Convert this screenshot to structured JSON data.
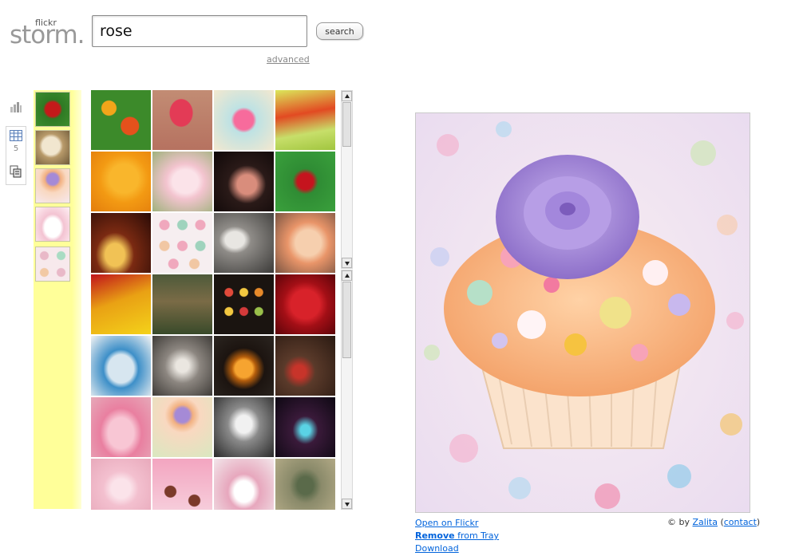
{
  "logo": {
    "small": "flickr",
    "big": "storm."
  },
  "search": {
    "value": "rose",
    "button": "search",
    "advanced": "advanced"
  },
  "sidebar": {
    "tray_count": "5"
  },
  "icons": {
    "tool_1": "bar-graph-icon",
    "tool_2": "grid-view-icon",
    "tool_3": "copy-icon"
  },
  "tray": {
    "items": [
      {
        "subject": "red rose"
      },
      {
        "subject": "dog on grass"
      },
      {
        "subject": "purple rose cupcake"
      },
      {
        "subject": "pink cake"
      },
      {
        "subject": "cupcakes"
      }
    ]
  },
  "results": {
    "rows": [
      [
        "marigolds",
        "pink rosebud",
        "collage",
        "green tulips"
      ],
      [
        "yellow rose",
        "white rose",
        "hands",
        "red rose"
      ],
      [
        "dark still life",
        "cupcake grid",
        "cat and rose",
        "peach rose"
      ],
      [
        "drop",
        "cottage",
        "chocolates",
        "red rose macro"
      ],
      [
        "kitchen",
        "dried flowers",
        "orange slice",
        "room"
      ],
      [
        "teacups",
        "cupcake",
        "face",
        "bracelet"
      ],
      [
        "pink rose",
        "cupcakes",
        "figurine",
        "green figure"
      ]
    ]
  },
  "preview": {
    "subject": "cupcake with purple rose",
    "links": {
      "open": "Open on Flickr",
      "remove_bold": "Remove",
      "remove_rest": " from Tray",
      "download": "Download"
    },
    "credit": {
      "prefix": "© by",
      "author": "Zalita",
      "contact": "contact"
    }
  },
  "colors": {
    "tray_bg": "#ffff99",
    "link": "#0063dc"
  }
}
